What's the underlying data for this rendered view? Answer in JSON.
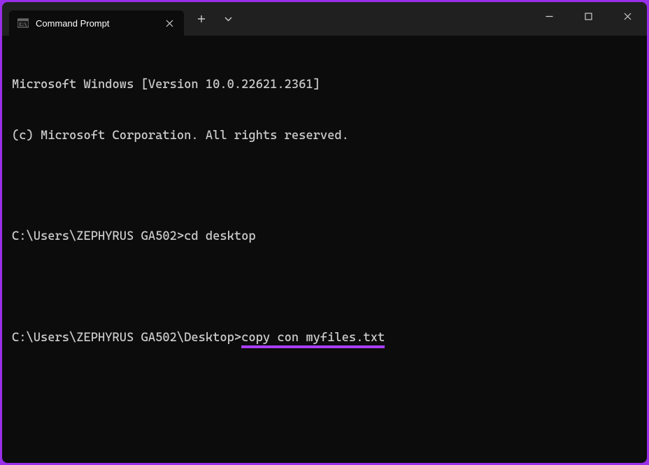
{
  "titlebar": {
    "tab_title": "Command Prompt"
  },
  "terminal": {
    "line1": "Microsoft Windows [Version 10.0.22621.2361]",
    "line2": "(c) Microsoft Corporation. All rights reserved.",
    "prompt1": "C:\\Users\\ZEPHYRUS GA502>",
    "cmd1": "cd desktop",
    "prompt2": "C:\\Users\\ZEPHYRUS GA502\\Desktop>",
    "cmd2": "copy con myfiles.txt"
  }
}
